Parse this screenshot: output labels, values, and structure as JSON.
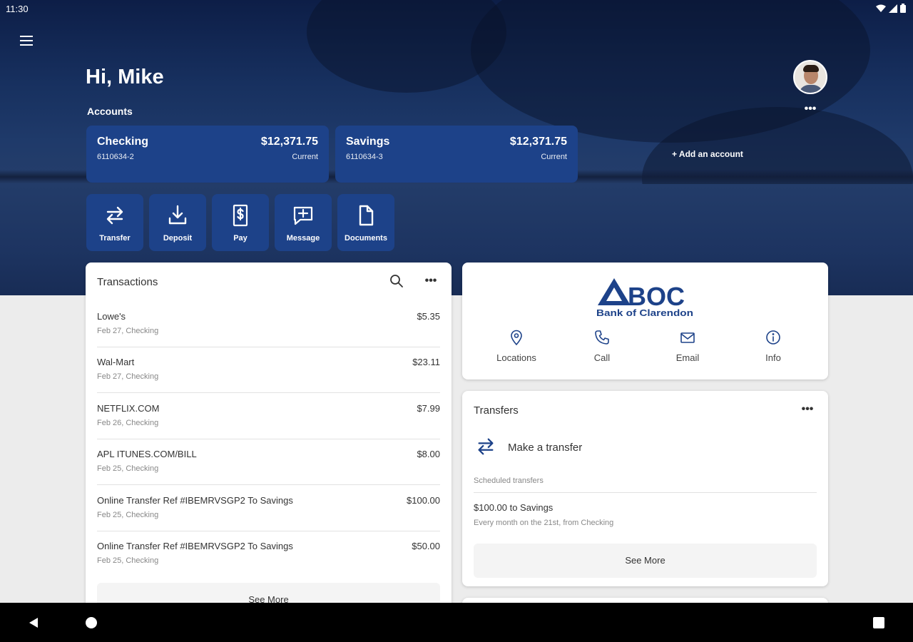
{
  "status_bar": {
    "time": "11:30"
  },
  "header": {
    "greeting": "Hi, Mike",
    "accounts_label": "Accounts",
    "add_account_label": "+ Add an account"
  },
  "accounts": [
    {
      "name": "Checking",
      "number": "6110634-2",
      "balance": "$12,371.75",
      "balance_type": "Current"
    },
    {
      "name": "Savings",
      "number": "6110634-3",
      "balance": "$12,371.75",
      "balance_type": "Current"
    }
  ],
  "quick_actions": [
    {
      "label": "Transfer",
      "icon": "transfer-icon"
    },
    {
      "label": "Deposit",
      "icon": "deposit-icon"
    },
    {
      "label": "Pay",
      "icon": "pay-icon"
    },
    {
      "label": "Message",
      "icon": "message-icon"
    },
    {
      "label": "Documents",
      "icon": "documents-icon"
    }
  ],
  "transactions": {
    "title": "Transactions",
    "see_more_label": "See More",
    "items": [
      {
        "description": "Lowe's",
        "detail": "Feb 27, Checking",
        "amount": "$5.35"
      },
      {
        "description": "Wal-Mart",
        "detail": "Feb 27, Checking",
        "amount": "$23.11"
      },
      {
        "description": "NETFLIX.COM",
        "detail": "Feb 26, Checking",
        "amount": "$7.99"
      },
      {
        "description": "APL ITUNES.COM/BILL",
        "detail": "Feb 25, Checking",
        "amount": "$8.00"
      },
      {
        "description": "Online Transfer Ref #IBEMRVSGP2 To Savings",
        "detail": "Feb 25, Checking",
        "amount": "$100.00"
      },
      {
        "description": "Online Transfer Ref #IBEMRVSGP2 To Savings",
        "detail": "Feb 25, Checking",
        "amount": "$50.00"
      }
    ]
  },
  "bank": {
    "logo_text": "BOC",
    "logo_subtext": "Bank of Clarendon",
    "actions": [
      {
        "label": "Locations",
        "icon": "location-pin-icon"
      },
      {
        "label": "Call",
        "icon": "phone-icon"
      },
      {
        "label": "Email",
        "icon": "email-icon"
      },
      {
        "label": "Info",
        "icon": "info-icon"
      }
    ]
  },
  "transfers": {
    "title": "Transfers",
    "make_transfer_label": "Make a transfer",
    "scheduled_label": "Scheduled transfers",
    "scheduled": [
      {
        "title": "$100.00 to Savings",
        "detail": "Every month on the 21st, from Checking"
      }
    ],
    "see_more_label": "See More"
  },
  "colors": {
    "brand_blue": "#1d4289",
    "hero_dark": "#0d1e47",
    "page_bg": "#ececec"
  }
}
